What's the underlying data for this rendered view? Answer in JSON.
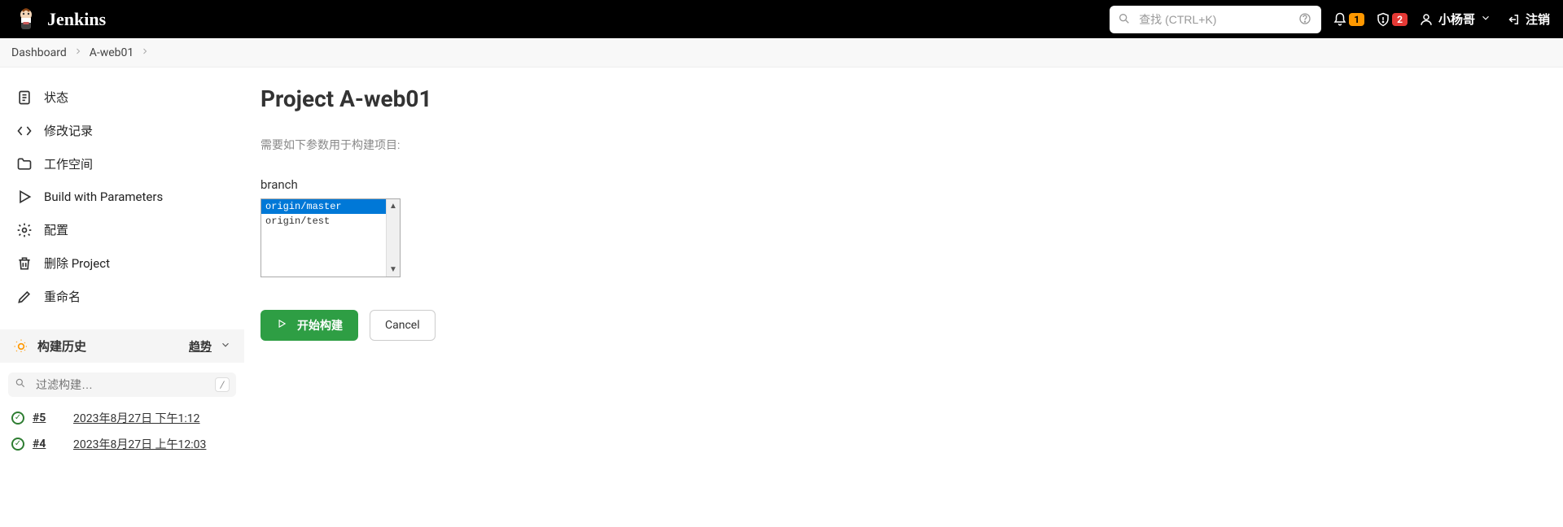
{
  "header": {
    "app_name": "Jenkins",
    "search_placeholder": "查找 (CTRL+K)",
    "notif_count": "1",
    "alert_count": "2",
    "username": "小杨哥",
    "logout_label": "注销"
  },
  "breadcrumb": {
    "items": [
      "Dashboard",
      "A-web01"
    ]
  },
  "sidebar": {
    "nav": [
      {
        "label": "状态"
      },
      {
        "label": "修改记录"
      },
      {
        "label": "工作空间"
      },
      {
        "label": "Build with Parameters"
      },
      {
        "label": "配置"
      },
      {
        "label": "删除 Project"
      },
      {
        "label": "重命名"
      }
    ],
    "build_history": {
      "title": "构建历史",
      "trend_label": "趋势",
      "filter_placeholder": "过滤构建…",
      "slash_hint": "/",
      "rows": [
        {
          "num": "#5",
          "date": "2023年8月27日 下午1:12"
        },
        {
          "num": "#4",
          "date": "2023年8月27日 上午12:03"
        }
      ]
    }
  },
  "content": {
    "title": "Project A-web01",
    "param_desc": "需要如下参数用于构建项目:",
    "param_label": "branch",
    "options": [
      "origin/master",
      "origin/test"
    ],
    "build_button": "开始构建",
    "cancel_button": "Cancel"
  }
}
